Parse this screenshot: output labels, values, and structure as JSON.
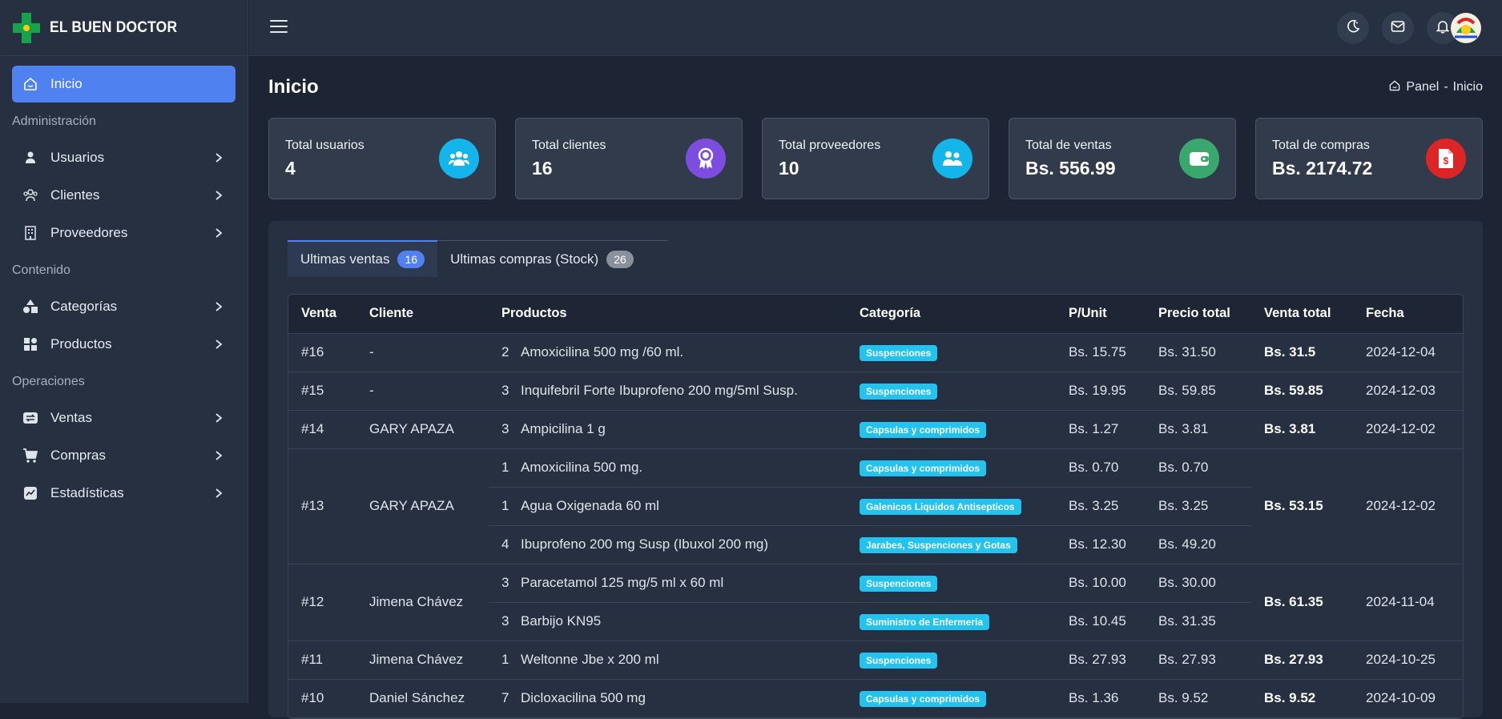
{
  "brand": {
    "name": "EL BUEN DOCTOR"
  },
  "sidebar": {
    "active": {
      "label": "Inicio"
    },
    "sections": [
      {
        "heading": "Administración",
        "items": [
          {
            "label": "Usuarios"
          },
          {
            "label": "Clientes"
          },
          {
            "label": "Proveedores"
          }
        ]
      },
      {
        "heading": "Contenido",
        "items": [
          {
            "label": "Categorías"
          },
          {
            "label": "Productos"
          }
        ]
      },
      {
        "heading": "Operaciones",
        "items": [
          {
            "label": "Ventas"
          },
          {
            "label": "Compras"
          },
          {
            "label": "Estadísticas"
          }
        ]
      }
    ]
  },
  "header": {
    "title": "Inicio",
    "breadcrumb": {
      "home": "Panel",
      "sep": "-",
      "current": "Inicio"
    }
  },
  "cards": [
    {
      "title": "Total usuarios",
      "value": "4",
      "color": "#13b5ea",
      "icon": "users-icon"
    },
    {
      "title": "Total clientes",
      "value": "16",
      "color": "#7c4ddf",
      "icon": "award-icon"
    },
    {
      "title": "Total proveedores",
      "value": "10",
      "color": "#13b5ea",
      "icon": "people-icon"
    },
    {
      "title": "Total de ventas",
      "value": "Bs. 556.99",
      "color": "#3aa76d",
      "icon": "wallet-icon"
    },
    {
      "title": "Total de compras",
      "value": "Bs. 2174.72",
      "color": "#dc2626",
      "icon": "invoice-icon"
    }
  ],
  "tabs": [
    {
      "label": "Ultimas ventas",
      "count": "16"
    },
    {
      "label": "Ultimas compras (Stock)",
      "count": "26"
    }
  ],
  "table": {
    "headers": [
      "Venta",
      "Cliente",
      "Productos",
      "Categoría",
      "P/Unit",
      "Precio total",
      "Venta total",
      "Fecha"
    ],
    "rows": [
      {
        "venta": "#16",
        "cliente": "-",
        "total": "Bs. 31.5",
        "fecha": "2024-12-04",
        "items": [
          {
            "qty": "2",
            "product": "Amoxicilina 500 mg /60 ml.",
            "category": "Suspenciones",
            "unit": "Bs. 15.75",
            "price": "Bs. 31.50"
          }
        ]
      },
      {
        "venta": "#15",
        "cliente": "-",
        "total": "Bs. 59.85",
        "fecha": "2024-12-03",
        "items": [
          {
            "qty": "3",
            "product": "Inquifebril Forte Ibuprofeno 200 mg/5ml Susp.",
            "category": "Suspenciones",
            "unit": "Bs. 19.95",
            "price": "Bs. 59.85"
          }
        ]
      },
      {
        "venta": "#14",
        "cliente": "GARY APAZA",
        "total": "Bs. 3.81",
        "fecha": "2024-12-02",
        "items": [
          {
            "qty": "3",
            "product": "Ampicilina 1 g",
            "category": "Capsulas y comprimidos",
            "unit": "Bs. 1.27",
            "price": "Bs. 3.81"
          }
        ]
      },
      {
        "venta": "#13",
        "cliente": "GARY APAZA",
        "total": "Bs. 53.15",
        "fecha": "2024-12-02",
        "items": [
          {
            "qty": "1",
            "product": "Amoxicilina 500 mg.",
            "category": "Capsulas y comprimidos",
            "unit": "Bs. 0.70",
            "price": "Bs. 0.70"
          },
          {
            "qty": "1",
            "product": "Agua Oxigenada 60 ml",
            "category": "Galenicos Liquidos Antisepticos",
            "unit": "Bs. 3.25",
            "price": "Bs. 3.25"
          },
          {
            "qty": "4",
            "product": "Ibuprofeno 200 mg Susp (Ibuxol 200 mg)",
            "category": "Jarabes, Suspenciones y Gotas",
            "unit": "Bs. 12.30",
            "price": "Bs. 49.20"
          }
        ]
      },
      {
        "venta": "#12",
        "cliente": "Jimena Chávez",
        "total": "Bs. 61.35",
        "fecha": "2024-11-04",
        "items": [
          {
            "qty": "3",
            "product": "Paracetamol 125 mg/5 ml x 60 ml",
            "category": "Suspenciones",
            "unit": "Bs. 10.00",
            "price": "Bs. 30.00"
          },
          {
            "qty": "3",
            "product": "Barbijo KN95",
            "category": "Suministro de Enfermería",
            "unit": "Bs. 10.45",
            "price": "Bs. 31.35"
          }
        ]
      },
      {
        "venta": "#11",
        "cliente": "Jimena Chávez",
        "total": "Bs. 27.93",
        "fecha": "2024-10-25",
        "items": [
          {
            "qty": "1",
            "product": "Weltonne Jbe x 200 ml",
            "category": "Suspenciones",
            "unit": "Bs. 27.93",
            "price": "Bs. 27.93"
          }
        ]
      },
      {
        "venta": "#10",
        "cliente": "Daniel Sánchez",
        "total": "Bs. 9.52",
        "fecha": "2024-10-09",
        "items": [
          {
            "qty": "7",
            "product": "Dicloxacilina 500 mg",
            "category": "Capsulas y comprimidos",
            "unit": "Bs. 1.36",
            "price": "Bs. 9.52"
          }
        ]
      }
    ]
  }
}
